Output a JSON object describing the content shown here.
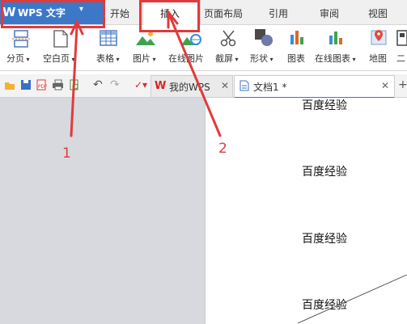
{
  "app": {
    "title": "WPS 文字",
    "logo": "W"
  },
  "menu_tabs": [
    "开始",
    "插入",
    "页面布局",
    "引用",
    "审阅",
    "视图"
  ],
  "ribbon": [
    {
      "label": "分页",
      "icon": "page-break-icon",
      "dropdown": true
    },
    {
      "label": "空白页",
      "icon": "blank-page-icon",
      "dropdown": true
    },
    {
      "label": "表格",
      "icon": "table-icon",
      "dropdown": true
    },
    {
      "label": "图片",
      "icon": "picture-icon",
      "dropdown": true
    },
    {
      "label": "在线图片",
      "icon": "online-picture-icon"
    },
    {
      "label": "截屏",
      "icon": "screenshot-icon",
      "dropdown": true
    },
    {
      "label": "形状",
      "icon": "shapes-icon",
      "dropdown": true
    },
    {
      "label": "图表",
      "icon": "chart-icon"
    },
    {
      "label": "在线图表",
      "icon": "online-chart-icon",
      "dropdown": true
    },
    {
      "label": "地图",
      "icon": "map-icon"
    },
    {
      "label": "二",
      "icon": "qr-icon"
    }
  ],
  "doc_tabs": [
    {
      "label": "我的WPS",
      "icon": "wps-home-icon"
    },
    {
      "label": "文档1 *",
      "icon": "document-icon"
    }
  ],
  "document_lines": [
    "百度经验",
    "百度经验",
    "百度经验",
    "百度经验"
  ],
  "annotations": [
    "1",
    "2"
  ],
  "colors": {
    "wps_blue": "#3d78c8",
    "annotation_red": "#e03b3b",
    "workspace_gray": "#d7d9df"
  }
}
